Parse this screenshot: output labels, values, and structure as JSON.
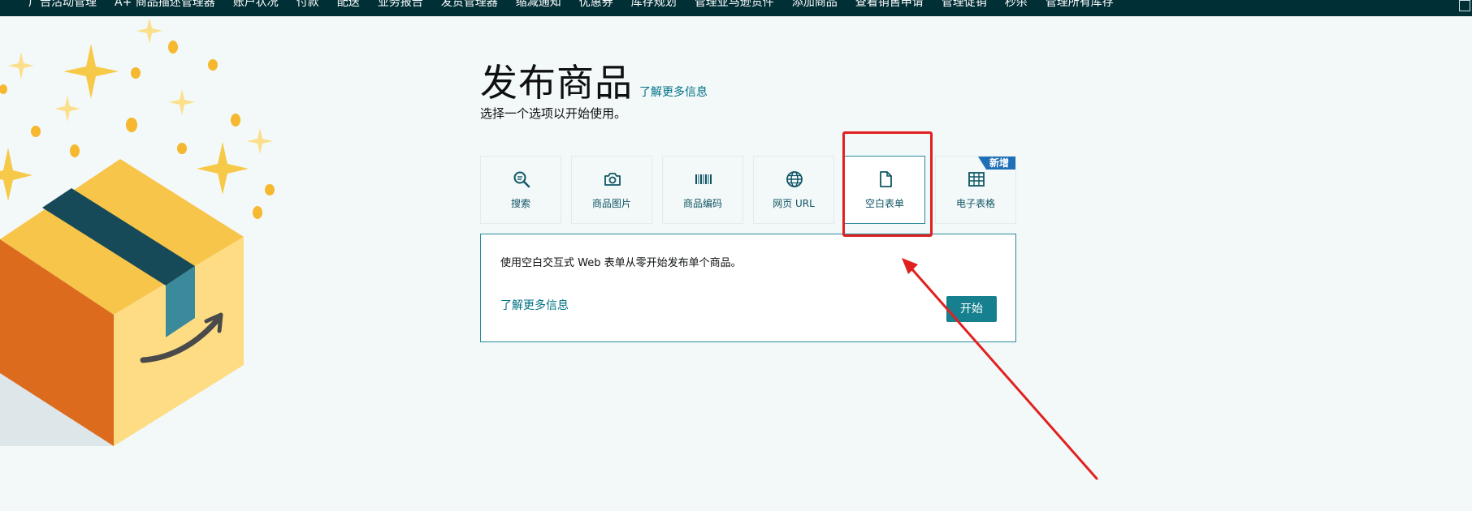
{
  "topnav": {
    "items": [
      "广告活动管理",
      "A+ 商品描述管理器",
      "账户状况",
      "付款",
      "配送",
      "业务报告",
      "发货管理器",
      "缩减通知",
      "优惠券",
      "库存规划",
      "管理亚马逊货件",
      "添加商品",
      "查看销售申请",
      "管理促销",
      "秒杀",
      "管理所有库存"
    ]
  },
  "header": {
    "title": "发布商品",
    "learn_more": "了解更多信息",
    "subtitle": "选择一个选项以开始使用。"
  },
  "options": [
    {
      "label": "搜索",
      "icon": "search-icon"
    },
    {
      "label": "商品图片",
      "icon": "camera-icon"
    },
    {
      "label": "商品编码",
      "icon": "barcode-icon"
    },
    {
      "label": "网页 URL",
      "icon": "globe-icon"
    },
    {
      "label": "空白表单",
      "icon": "document-icon",
      "selected": true
    },
    {
      "label": "电子表格",
      "icon": "spreadsheet-icon",
      "badge": "新增"
    }
  ],
  "panel": {
    "description": "使用空白交互式 Web 表单从零开始发布单个商品。",
    "learn_more": "了解更多信息",
    "start_label": "开始"
  },
  "colors": {
    "nav_bg": "#002f36",
    "accent": "#16808f",
    "link": "#007185",
    "annotation": "#e0211f",
    "badge": "#1f6fb7"
  }
}
